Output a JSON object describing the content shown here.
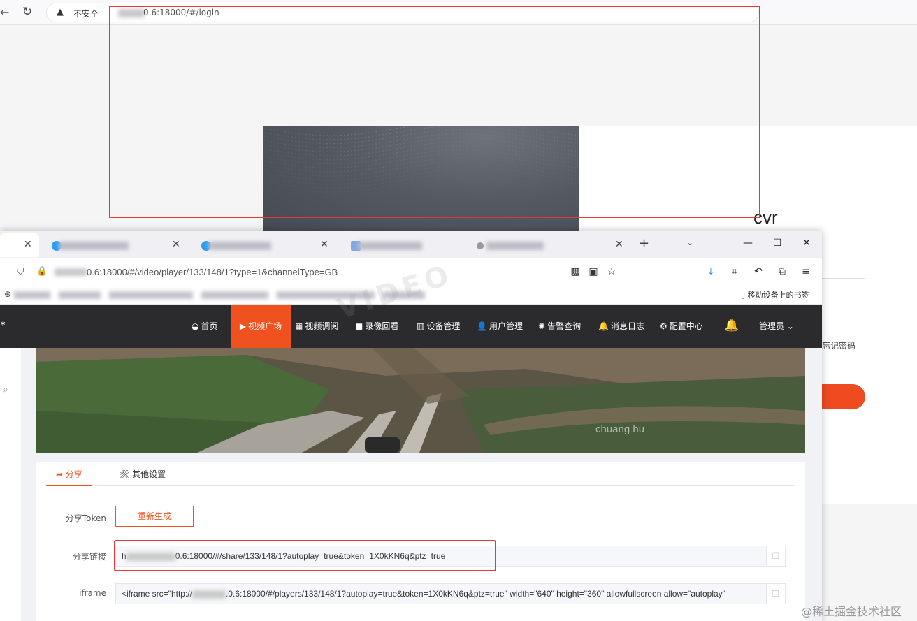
{
  "background_browser": {
    "back_icon": "arrow-left-icon",
    "reload_icon": "reload-icon",
    "security_icon": "warning-triangle-icon",
    "security_label": "不安全",
    "url_visible": "0.6:18000/#/login",
    "login": {
      "title": "cvr",
      "forgot_password": "忘记密码"
    }
  },
  "foreground_browser": {
    "tabs": [
      {
        "favicon_color": "#2a9df4"
      },
      {
        "favicon_color": "#2a9df4"
      },
      {
        "favicon_color": "#7fa8e8"
      },
      {
        "favicon_color": "#999999"
      }
    ],
    "new_tab_icon": "plus-icon",
    "tab_list_icon": "chevron-down-icon",
    "window_controls": [
      "minimize-icon",
      "maximize-icon",
      "close-icon"
    ],
    "url_visible": "0.6:18000/#/video/player/133/148/1?type=1&channelType=GB",
    "bookmarks_mobile_label": "移动设备上的书签"
  },
  "app": {
    "nav": [
      {
        "icon": "dashboard-icon",
        "glyph": "◒",
        "label": "首页"
      },
      {
        "icon": "play-circle-icon",
        "glyph": "▶",
        "label": "视频广场",
        "active": true
      },
      {
        "icon": "layout-icon",
        "glyph": "▦",
        "label": "视频调阅"
      },
      {
        "icon": "video-camera-icon",
        "glyph": "■",
        "label": "录像回看"
      },
      {
        "icon": "server-icon",
        "glyph": "▥",
        "label": "设备管理"
      },
      {
        "icon": "user-icon",
        "glyph": "👤",
        "label": "用户管理"
      },
      {
        "icon": "alarm-icon",
        "glyph": "✺",
        "label": "告警查询"
      },
      {
        "icon": "bell-icon",
        "glyph": "🔔",
        "label": "消息日志"
      },
      {
        "icon": "gear-icon",
        "glyph": "⚙",
        "label": "配置中心"
      }
    ],
    "user_label": "管理员",
    "accent": "#f0521f",
    "video_osd": "chuang hu",
    "settings": {
      "tabs": [
        {
          "icon": "share-icon",
          "glyph": "➦",
          "label": "分享"
        },
        {
          "icon": "tools-icon",
          "glyph": "🛠",
          "label": "其他设置"
        }
      ],
      "share_token_label": "分享Token",
      "regenerate_label": "重新生成",
      "share_link_label": "分享链接",
      "share_link_prefix": "h",
      "share_link_value": "0.6:18000/#/share/133/148/1?autoplay=true&token=1X0kKN6q&ptz=true",
      "iframe_label": "iframe",
      "iframe_prefix": "<iframe src=\"http://",
      "iframe_value": ".0.6:18000/#/players/133/148/1?autoplay=true&token=1X0kKN6q&ptz=true\" width=\"640\" height=\"360\" allowfullscreen allow=\"autoplay\""
    }
  },
  "watermark": "@稀土掘金技术社区"
}
